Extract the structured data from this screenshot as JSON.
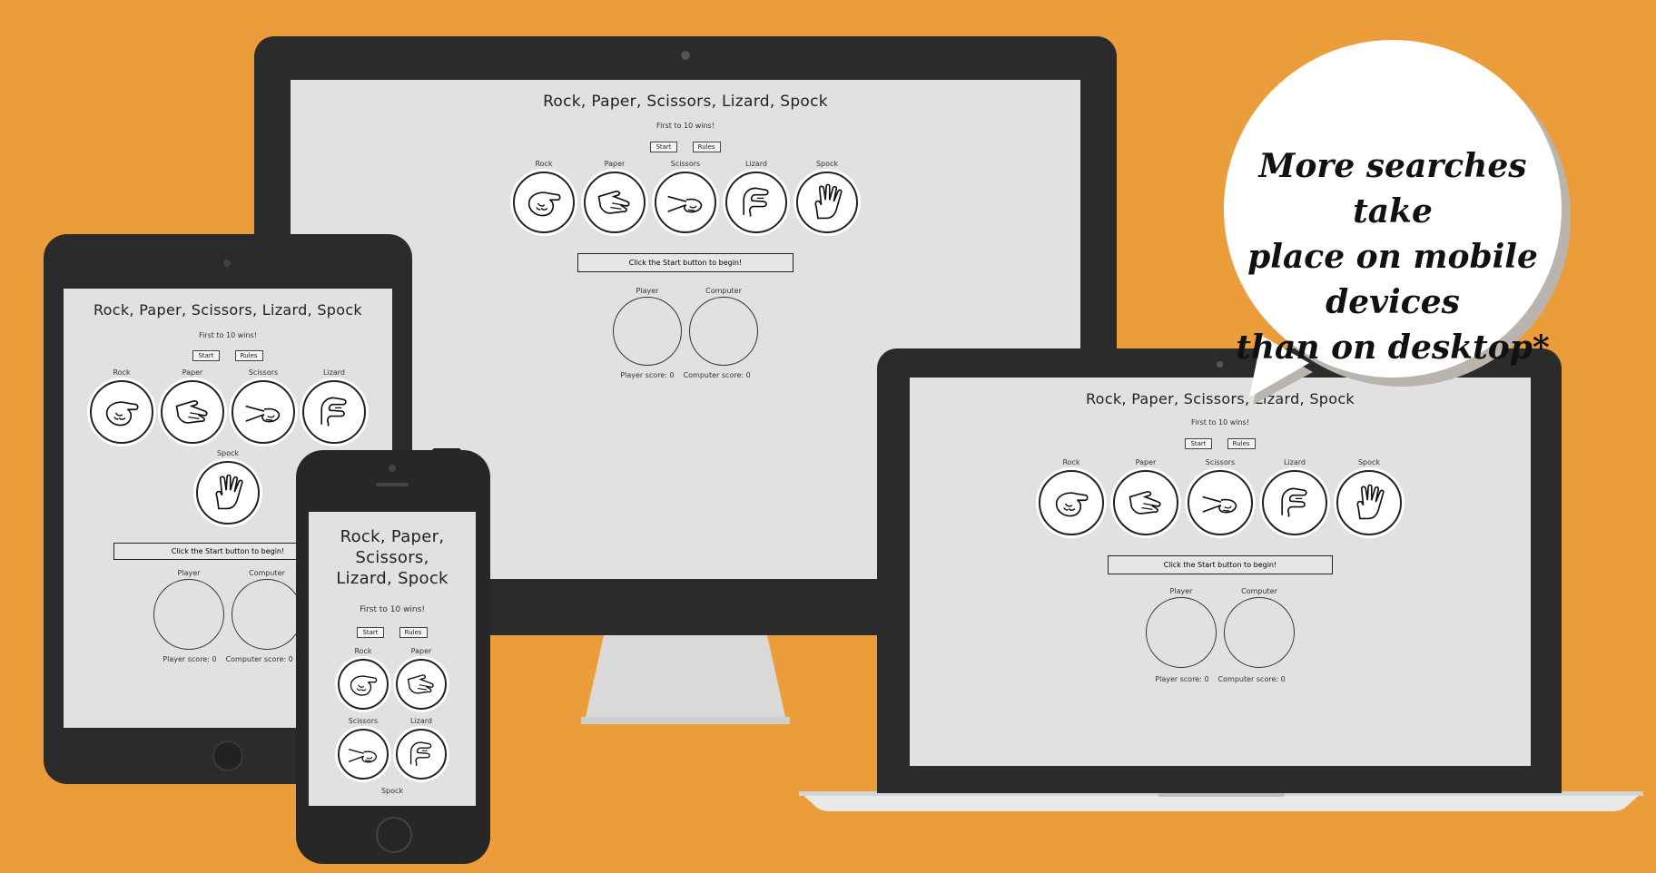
{
  "app": {
    "title": "Rock, Paper, Scissors, Lizard, Spock",
    "phone_title_lines": [
      "Rock, Paper,",
      "Scissors,",
      "Lizard, Spock"
    ],
    "tagline": "First to 10 wins!",
    "start_label": "Start",
    "rules_label": "Rules",
    "choices": [
      "Rock",
      "Paper",
      "Scissors",
      "Lizard",
      "Spock"
    ],
    "message": "Click the Start button to begin!",
    "player_label": "Player",
    "computer_label": "Computer",
    "player_score": "Player score: 0",
    "computer_score": "Computer score: 0"
  },
  "bubble": {
    "lines": [
      "More searches take",
      "place on mobile devices",
      "than on desktop*"
    ]
  },
  "colors": {
    "background": "#ec9d3b",
    "device_frame": "#2b2b2b",
    "screen": "#e1e1e1"
  },
  "icons": [
    "rock-hand-icon",
    "paper-hand-icon",
    "scissors-hand-icon",
    "lizard-hand-icon",
    "spock-hand-icon"
  ]
}
